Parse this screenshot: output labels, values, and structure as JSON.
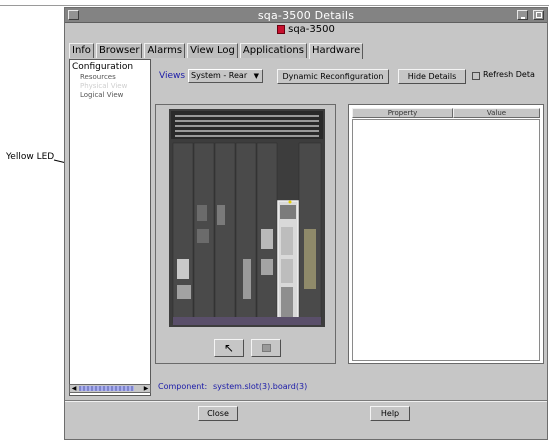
{
  "callout": {
    "label": "Yellow LED"
  },
  "window": {
    "title": "sqa-3500 Details",
    "subtitle": "sqa-3500"
  },
  "tabs": [
    {
      "label": "Info"
    },
    {
      "label": "Browser"
    },
    {
      "label": "Alarms"
    },
    {
      "label": "View Log"
    },
    {
      "label": "Applications"
    },
    {
      "label": "Hardware",
      "active": true
    }
  ],
  "tree": {
    "root": "Configuration",
    "items": [
      {
        "label": "Resources"
      },
      {
        "label": "Physical View",
        "selected": true
      },
      {
        "label": "Logical View"
      }
    ]
  },
  "toolbar": {
    "views_label": "Views",
    "views_selected": "System - Rear",
    "dynamic_reconfiguration": "Dynamic Reconfiguration",
    "hide_details": "Hide Details",
    "refresh_label": "Refresh Deta",
    "refresh_checked": false
  },
  "details_table": {
    "columns": [
      "Property",
      "Value"
    ],
    "rows": []
  },
  "component": {
    "label": "Component:",
    "value": "system.slot(3).board(3)"
  },
  "footer": {
    "close_label": "Close",
    "help_label": "Help"
  },
  "icons": {
    "window_menu": "window-menu-icon",
    "minimize": "minimize-icon",
    "maximize": "maximize-icon",
    "host": "host-icon",
    "select_tool": "select-pointer-icon",
    "zoom_tool": "zoom-icon"
  }
}
